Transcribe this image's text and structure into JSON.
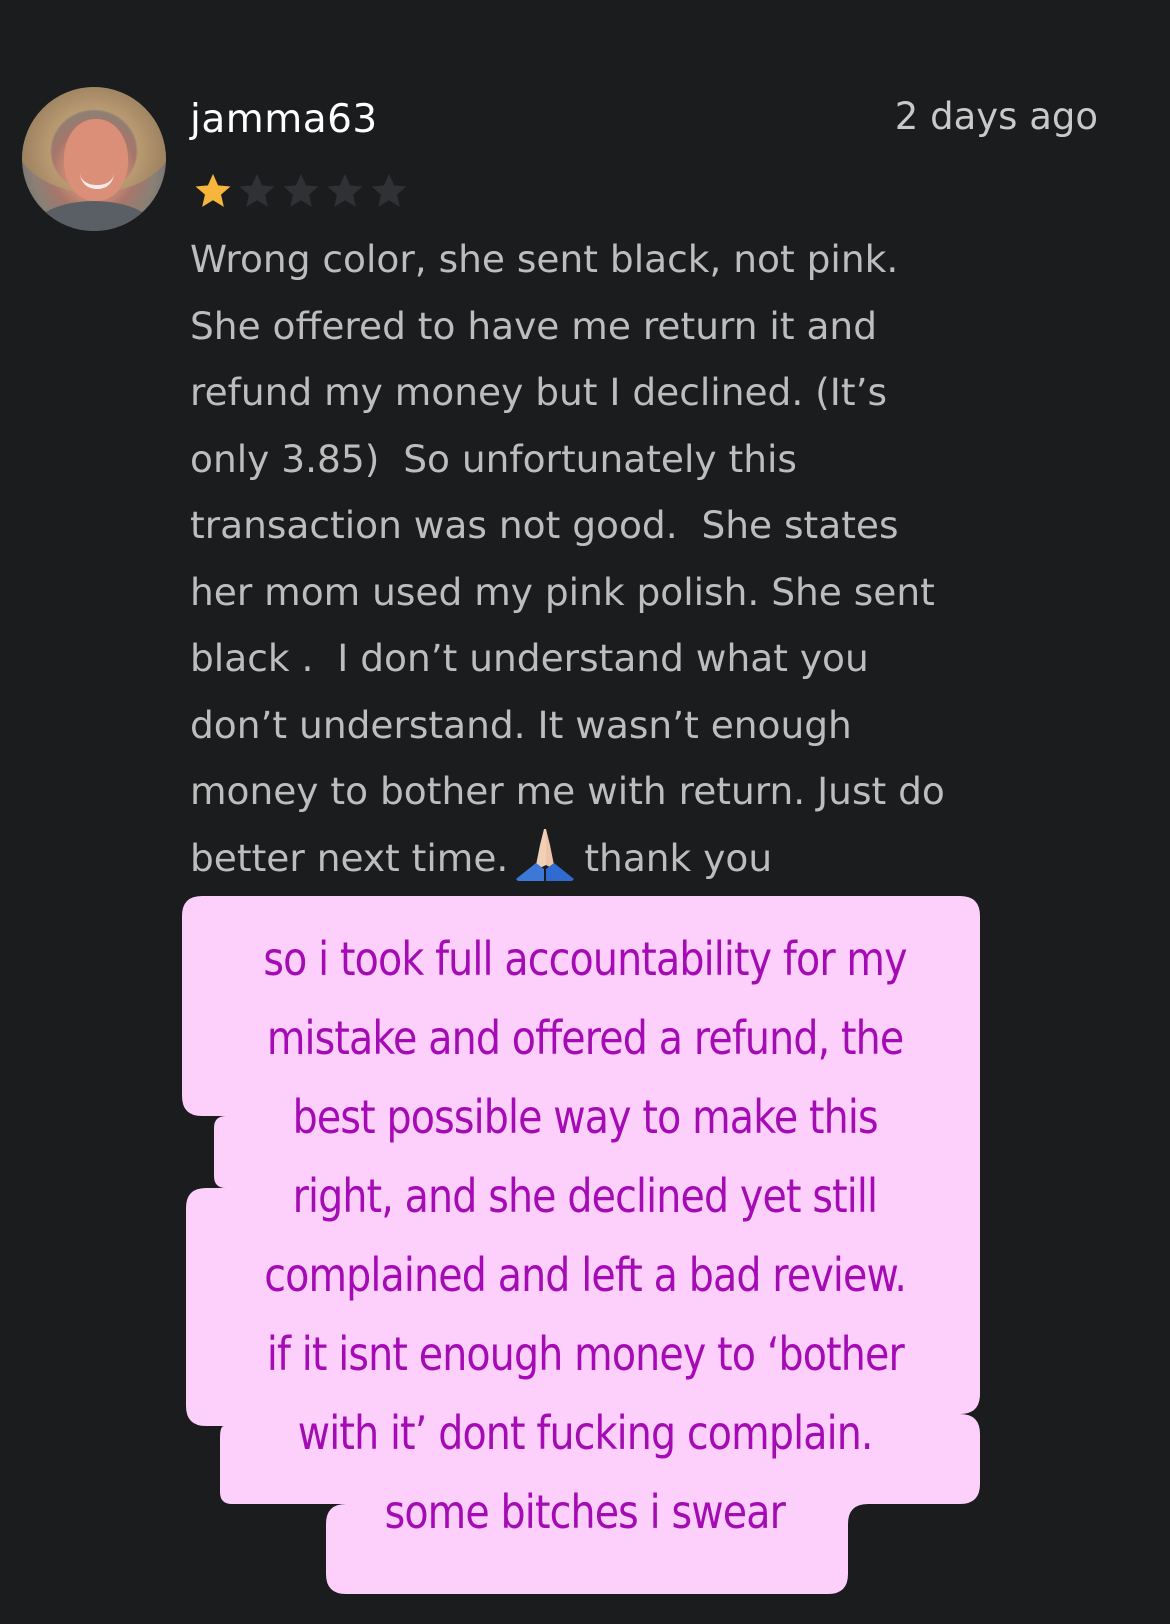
{
  "review": {
    "username": "jamma63",
    "timestamp": "2 days ago",
    "rating": 1,
    "max_rating": 5,
    "avatar_icon": "user-avatar-photo",
    "text_lines": [
      "Wrong color, she sent black, not pink.",
      "She offered to have me return it and",
      "refund my money but I declined. (It’s",
      "only 3.85)  So unfortunately this",
      "transaction was not good.  She states",
      "her mom used my pink polish. She sent",
      "black .  I don’t understand what you",
      "don’t understand. It wasn’t enough",
      "money to bother me with return. Just do"
    ],
    "last_line_before_emoji": "better next time.",
    "emoji": "folded-hands-icon",
    "last_line_after_emoji": "thank you"
  },
  "caption": {
    "lines": [
      "so i took full accountability for my",
      "mistake and offered a refund, the",
      "best possible way to make this",
      "right, and she declined yet still",
      "complained and left a bad review.",
      "if it isnt enough money to ‘bother",
      "with it’ dont fucking complain.",
      "some bitches i swear"
    ]
  },
  "colors": {
    "background": "#1b1c1e",
    "star_filled": "#f6b63b",
    "star_empty": "#2f3134",
    "review_text": "#bdbdbd",
    "caption_bg": "#fcd0fb",
    "caption_text": "#a50bb4"
  }
}
